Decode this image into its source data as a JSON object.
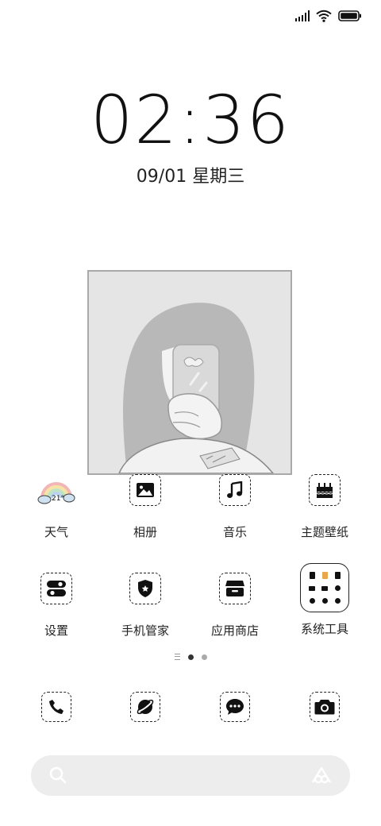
{
  "status_bar": {
    "signal_icon": "signal-icon",
    "wifi_icon": "wifi-icon",
    "battery_icon": "battery-icon"
  },
  "lock": {
    "time": "02:36",
    "date": "09/01 星期三"
  },
  "widget": {
    "icon": "photo-widget",
    "accent": "#e5e5e5"
  },
  "apps_row1": [
    {
      "label": "天气",
      "icon": "weather-rainbow-icon",
      "temp": "21°"
    },
    {
      "label": "相册",
      "icon": "gallery-icon"
    },
    {
      "label": "音乐",
      "icon": "music-note-icon"
    },
    {
      "label": "主题壁纸",
      "icon": "theme-cake-icon"
    }
  ],
  "apps_row2": [
    {
      "label": "设置",
      "icon": "settings-toggle-icon"
    },
    {
      "label": "手机管家",
      "icon": "security-shield-icon"
    },
    {
      "label": "应用商店",
      "icon": "app-store-icon"
    },
    {
      "label": "系统工具",
      "icon": "system-tools-folder-icon"
    }
  ],
  "page_indicator": {
    "pages": 3,
    "current": 2
  },
  "dock": [
    {
      "icon": "phone-icon"
    },
    {
      "icon": "browser-planet-icon"
    },
    {
      "icon": "messages-icon"
    },
    {
      "icon": "camera-icon"
    }
  ],
  "search": {
    "icon": "search-icon",
    "assistant_icon": "assistant-icon"
  }
}
